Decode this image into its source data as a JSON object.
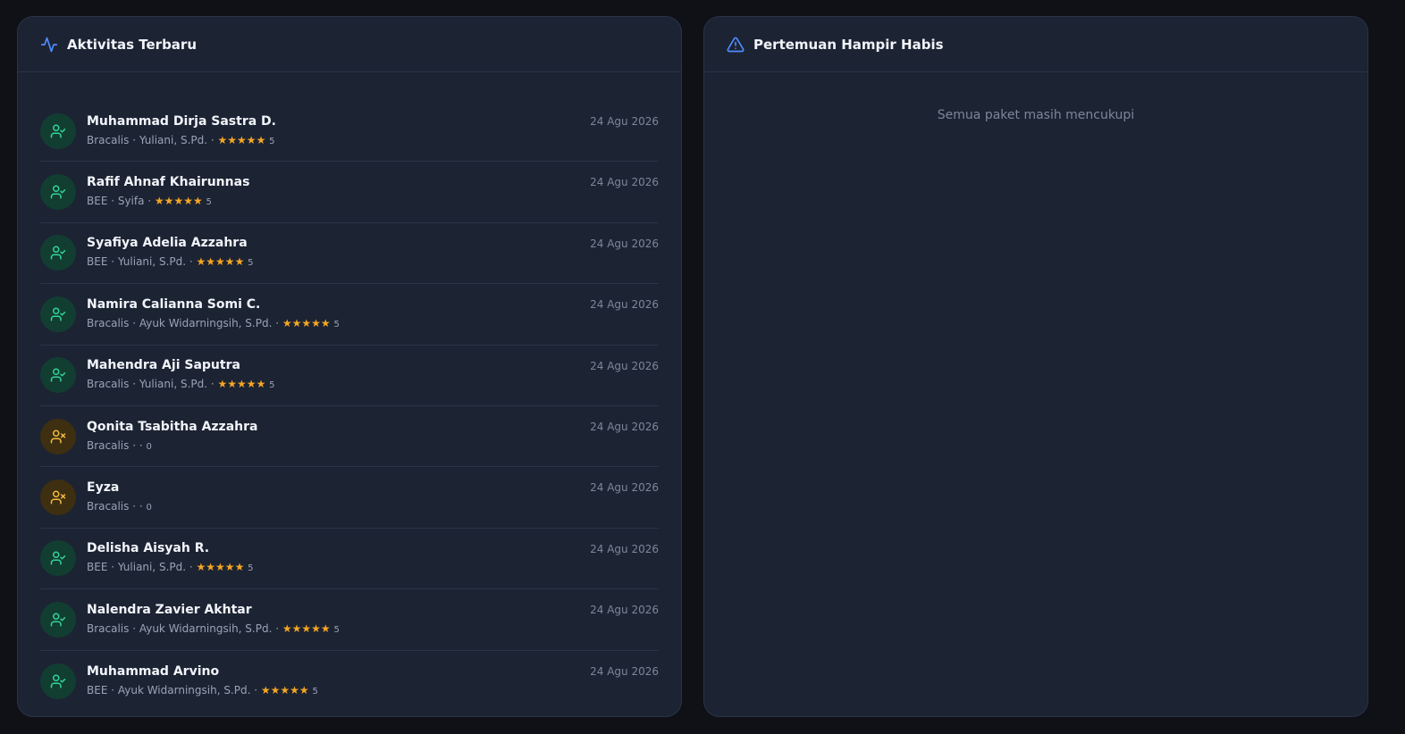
{
  "left_card": {
    "title": "Aktivitas Terbaru",
    "icon": "activity-icon"
  },
  "right_card": {
    "title": "Pertemuan Hampir Habis",
    "icon": "warning-triangle-icon",
    "empty_message": "Semua paket masih mencukupi"
  },
  "colors": {
    "accent_blue": "#4f8cff",
    "success_icon": "#34d399",
    "warning_icon": "#f5b942",
    "star": "#f5a623"
  },
  "activities": [
    {
      "name": "Muhammad Dirja Sastra D.",
      "meta": "Bracalis · Yuliani, S.Pd. · ",
      "stars": "★★★★★",
      "score": "5",
      "date": "24 Agu 2026",
      "status": "present"
    },
    {
      "name": "Rafif Ahnaf Khairunnas",
      "meta": "BEE · Syifa · ",
      "stars": "★★★★★",
      "score": "5",
      "date": "24 Agu 2026",
      "status": "present"
    },
    {
      "name": "Syafiya Adelia Azzahra",
      "meta": "BEE · Yuliani, S.Pd. · ",
      "stars": "★★★★★",
      "score": "5",
      "date": "24 Agu 2026",
      "status": "present"
    },
    {
      "name": "Namira Calianna Somi C.",
      "meta": "Bracalis · Ayuk Widarningsih, S.Pd. · ",
      "stars": "★★★★★",
      "score": "5",
      "date": "24 Agu 2026",
      "status": "present"
    },
    {
      "name": "Mahendra Aji Saputra",
      "meta": "Bracalis · Yuliani, S.Pd. · ",
      "stars": "★★★★★",
      "score": "5",
      "date": "24 Agu 2026",
      "status": "present"
    },
    {
      "name": "Qonita Tsabitha Azzahra",
      "meta": "Bracalis · · ",
      "stars": "",
      "score": "0",
      "date": "24 Agu 2026",
      "status": "absent"
    },
    {
      "name": "Eyza",
      "meta": "Bracalis · · ",
      "stars": "",
      "score": "0",
      "date": "24 Agu 2026",
      "status": "absent"
    },
    {
      "name": "Delisha Aisyah R.",
      "meta": "BEE · Yuliani, S.Pd. · ",
      "stars": "★★★★★",
      "score": "5",
      "date": "24 Agu 2026",
      "status": "present"
    },
    {
      "name": "Nalendra Zavier Akhtar",
      "meta": "Bracalis · Ayuk Widarningsih, S.Pd. · ",
      "stars": "★★★★★",
      "score": "5",
      "date": "24 Agu 2026",
      "status": "present"
    },
    {
      "name": "Muhammad Arvino",
      "meta": "BEE · Ayuk Widarningsih, S.Pd. · ",
      "stars": "★★★★★",
      "score": "5",
      "date": "24 Agu 2026",
      "status": "present"
    }
  ]
}
